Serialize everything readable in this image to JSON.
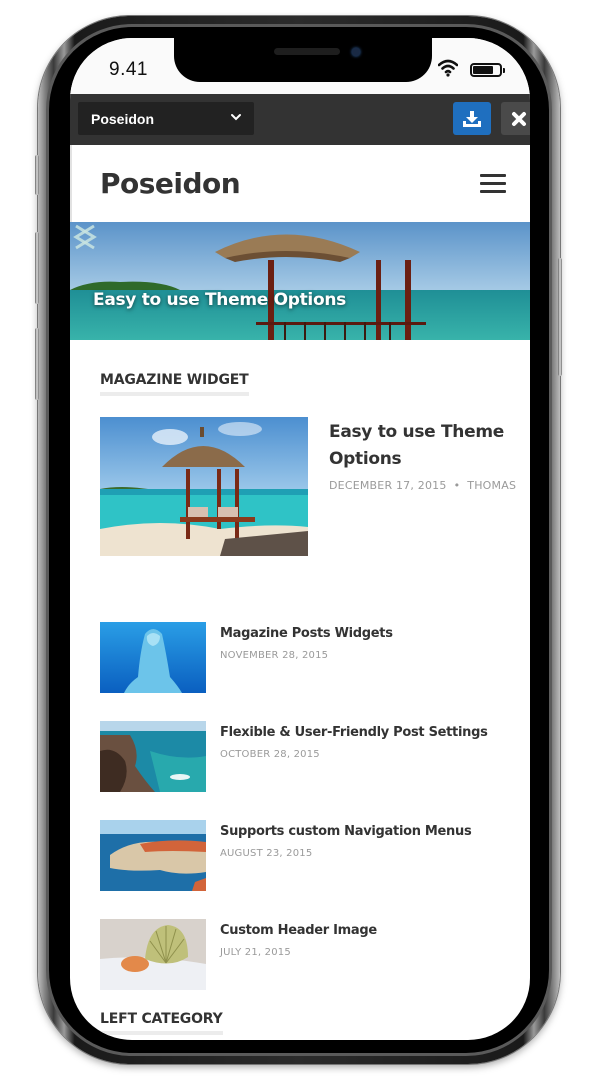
{
  "status_bar": {
    "time": "9.41",
    "icons": [
      "wifi-icon",
      "battery-icon"
    ]
  },
  "toolbar": {
    "theme_select_value": "Poseidon",
    "download_icon": "download-icon",
    "close_icon": "close-icon",
    "accent": "#1f6fbf"
  },
  "site": {
    "title": "Poseidon",
    "menu_icon": "hamburger-menu-icon"
  },
  "slider": {
    "caption": "Easy to use Theme Options",
    "prev_label": "<",
    "next_label": ">"
  },
  "magazine_widget": {
    "title": "MAGAZINE WIDGET",
    "featured": {
      "title": "Easy to use Theme Options",
      "date": "DECEMBER 17, 2015",
      "separator": "•",
      "author": "THOMAS",
      "image": "beach-gazebo"
    },
    "posts": [
      {
        "title": "Magazine Posts Widgets",
        "date": "NOVEMBER 28, 2015",
        "image": "dolphin"
      },
      {
        "title": "Flexible & User-Friendly Post Settings",
        "date": "OCTOBER 28, 2015",
        "image": "rocky-coast"
      },
      {
        "title": "Supports custom Navigation Menus",
        "date": "AUGUST 23, 2015",
        "image": "coastal-city"
      },
      {
        "title": "Custom Header Image",
        "date": "JULY 21, 2015",
        "image": "seashell"
      }
    ]
  },
  "left_category": {
    "title": "LEFT CATEGORY"
  }
}
